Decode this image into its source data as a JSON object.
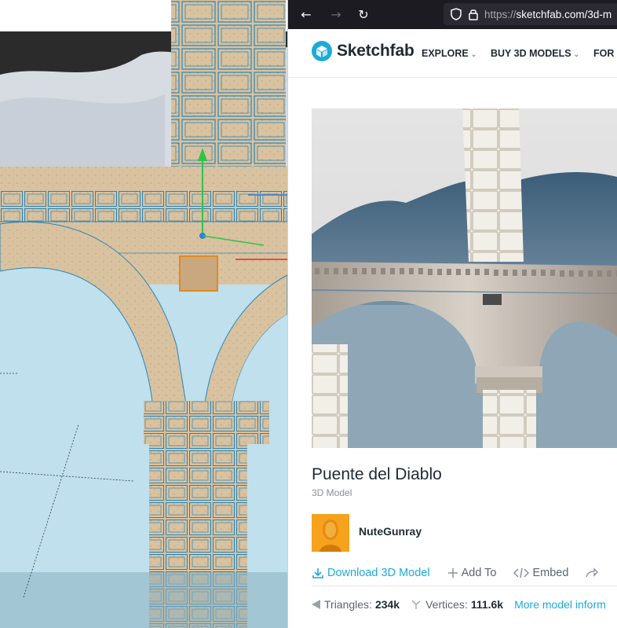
{
  "browser": {
    "url_proto": "https://",
    "url_rest": "sketchfab.com/3d-m",
    "back_icon": "back-arrow-icon",
    "forward_icon": "forward-arrow-icon",
    "reload_icon": "reload-icon"
  },
  "header": {
    "brand": "Sketchfab",
    "nav": [
      {
        "label": "EXPLORE"
      },
      {
        "label": "BUY 3D MODELS"
      },
      {
        "label": "FOR B"
      }
    ]
  },
  "model": {
    "title": "Puente del Diablo",
    "subtitle": "3D Model",
    "author": "NuteGunray"
  },
  "actions": {
    "download": "Download 3D Model",
    "add_to": "Add To",
    "embed": "Embed"
  },
  "stats": {
    "triangles_label": "Triangles:",
    "triangles_value": "234k",
    "vertices_label": "Vertices:",
    "vertices_value": "111.6k",
    "more_info": "More model inform"
  },
  "colors": {
    "accent": "#1caad9",
    "dark_text": "#1e2b33",
    "browser_chrome": "#1c1b22"
  }
}
